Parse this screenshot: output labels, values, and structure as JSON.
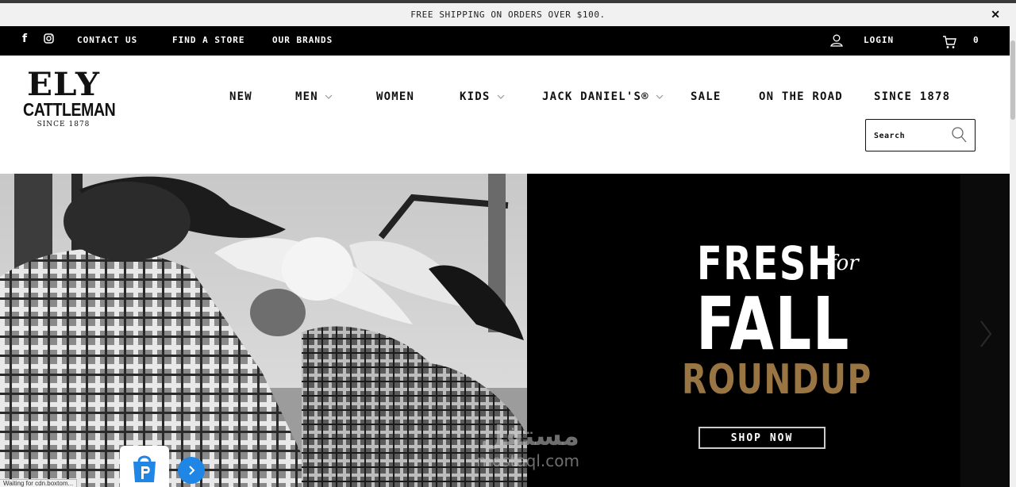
{
  "announcement": {
    "text": "FREE SHIPPING ON ORDERS OVER $100.",
    "close_glyph": "✕"
  },
  "utility": {
    "social": [
      {
        "name": "facebook-icon",
        "glyph": "f"
      },
      {
        "name": "instagram-icon",
        "glyph": "instagram"
      }
    ],
    "links": [
      "CONTACT US",
      "FIND A STORE",
      "OUR BRANDS"
    ],
    "login": "LOGIN",
    "cart_count": "0"
  },
  "logo": {
    "line1": "ELY",
    "line2": "CATTLEMAN",
    "line3": "SINCE 1878"
  },
  "nav": [
    {
      "label": "NEW",
      "dropdown": false
    },
    {
      "label": "MEN",
      "dropdown": true
    },
    {
      "label": "WOMEN",
      "dropdown": false
    },
    {
      "label": "KIDS",
      "dropdown": true
    },
    {
      "label": "JACK DANIEL'S®",
      "dropdown": true
    },
    {
      "label": "SALE",
      "dropdown": false
    },
    {
      "label": "ON THE ROAD",
      "dropdown": false
    },
    {
      "label": "SINCE 1878",
      "dropdown": false
    }
  ],
  "search": {
    "placeholder": "Search"
  },
  "hero": {
    "headline_1": "FRESH",
    "headline_for": "for",
    "headline_2": "FALL",
    "headline_3": "ROUNDUP",
    "cta": "SHOP NOW",
    "accent_color": "#9a7544"
  },
  "overlays": {
    "status_text": "Waiting for cdn.boxtom...",
    "watermark_ar": "مستقل",
    "watermark_en": "mostaql.com"
  }
}
